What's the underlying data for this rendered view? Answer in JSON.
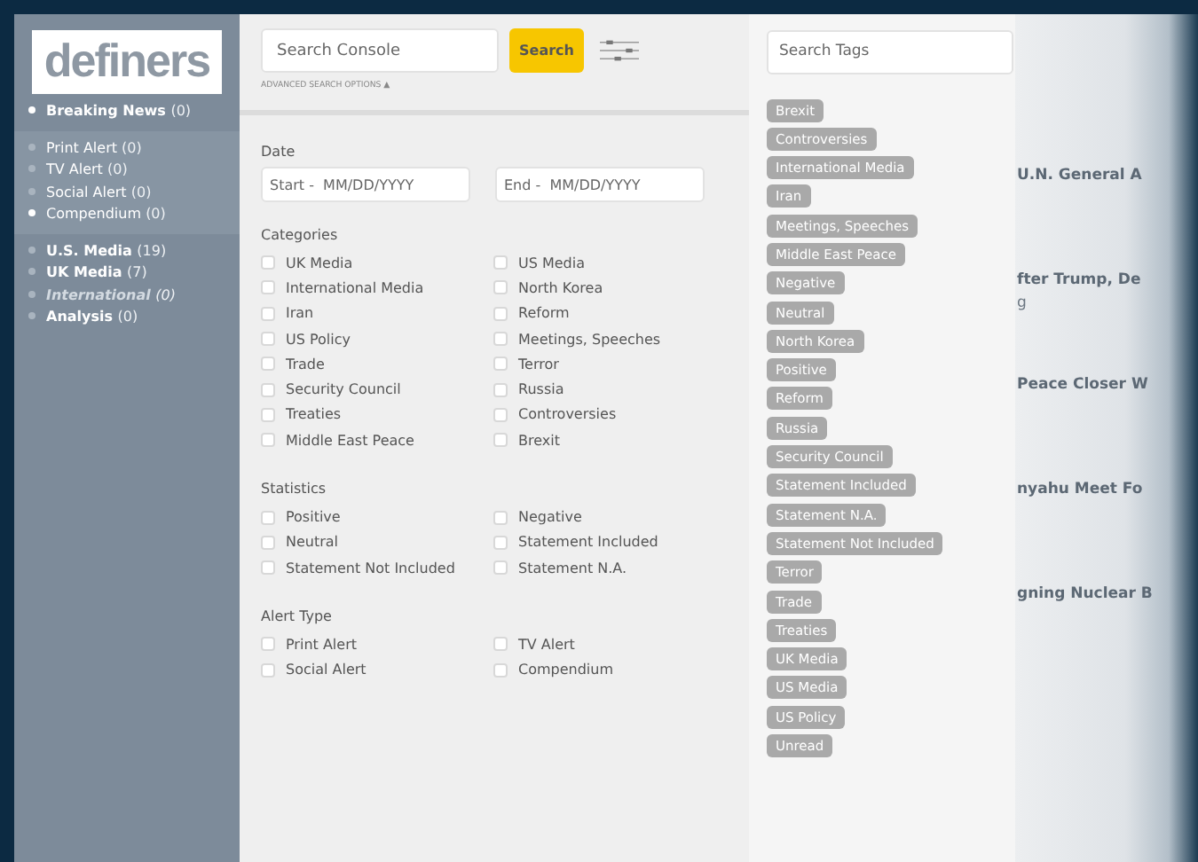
{
  "logo": "definers",
  "sidebar": {
    "groups": [
      {
        "kind": "plain",
        "items": [
          {
            "label": "Breaking News",
            "count": "(0)",
            "bold": true,
            "selected": true,
            "disabled": false
          }
        ]
      },
      {
        "kind": "band",
        "items": [
          {
            "label": "Print Alert",
            "count": "(0)",
            "bold": false,
            "selected": false,
            "disabled": false
          },
          {
            "label": "TV Alert",
            "count": "(0)",
            "bold": false,
            "selected": false,
            "disabled": false
          },
          {
            "label": "Social Alert",
            "count": "(0)",
            "bold": false,
            "selected": false,
            "disabled": false
          },
          {
            "label": "Compendium",
            "count": "(0)",
            "bold": false,
            "selected": true,
            "disabled": false
          }
        ]
      },
      {
        "kind": "plain",
        "items": [
          {
            "label": "U.S. Media",
            "count": "(19)",
            "bold": true,
            "selected": false,
            "disabled": false
          },
          {
            "label": "UK Media",
            "count": "(7)",
            "bold": true,
            "selected": false,
            "disabled": false
          },
          {
            "label": "International",
            "count": "(0)",
            "bold": true,
            "selected": false,
            "disabled": true
          },
          {
            "label": "Analysis",
            "count": "(0)",
            "bold": true,
            "selected": false,
            "disabled": false
          }
        ]
      }
    ]
  },
  "search": {
    "placeholder": "Search Console",
    "button": "Search",
    "advanced": "ADVANCED SEARCH OPTIONS ▲"
  },
  "date": {
    "label": "Date",
    "start_placeholder": "Start -  MM/DD/YYYY",
    "end_placeholder": "End -  MM/DD/YYYY"
  },
  "filter_groups": [
    {
      "title": "Categories",
      "options": [
        {
          "label": "UK Media",
          "checked": false
        },
        {
          "label": "US Media",
          "checked": false
        },
        {
          "label": "International Media",
          "checked": false
        },
        {
          "label": "North Korea",
          "checked": false
        },
        {
          "label": "Iran",
          "checked": false
        },
        {
          "label": "Reform",
          "checked": false
        },
        {
          "label": "US Policy",
          "checked": false
        },
        {
          "label": "Meetings, Speeches",
          "checked": false
        },
        {
          "label": "Trade",
          "checked": false
        },
        {
          "label": "Terror",
          "checked": false
        },
        {
          "label": "Security Council",
          "checked": false
        },
        {
          "label": "Russia",
          "checked": false
        },
        {
          "label": "Treaties",
          "checked": false
        },
        {
          "label": "Controversies",
          "checked": false
        },
        {
          "label": "Middle East Peace",
          "checked": false
        },
        {
          "label": "Brexit",
          "checked": false
        }
      ]
    },
    {
      "title": "Statistics",
      "options": [
        {
          "label": "Positive",
          "checked": false
        },
        {
          "label": "Negative",
          "checked": false
        },
        {
          "label": "Neutral",
          "checked": false
        },
        {
          "label": "Statement Included",
          "checked": false
        },
        {
          "label": "Statement Not Included",
          "checked": false
        },
        {
          "label": "Statement N.A.",
          "checked": false
        }
      ]
    },
    {
      "title": "Alert Type",
      "options": [
        {
          "label": "Print Alert",
          "checked": false
        },
        {
          "label": "TV Alert",
          "checked": false
        },
        {
          "label": "Social Alert",
          "checked": false
        },
        {
          "label": "Compendium",
          "checked": false
        }
      ]
    }
  ],
  "tags": {
    "placeholder": "Search Tags",
    "items": [
      "Brexit",
      "Controversies",
      "International Media",
      "Iran",
      "Meetings, Speeches",
      "Middle East Peace",
      "Negative",
      "Neutral",
      "North Korea",
      "Positive",
      "Reform",
      "Russia",
      "Security Council",
      "Statement Included",
      "Statement N.A.",
      "Statement Not Included",
      "Terror",
      "Trade",
      "Treaties",
      "UK Media",
      "US Media",
      "US Policy",
      "Unread"
    ]
  },
  "background_headlines": [
    {
      "title": "U.N. General A"
    },
    {
      "title": "fter Trump, De",
      "sub": "g"
    },
    {
      "title": "Peace Closer W"
    },
    {
      "title": "nyahu Meet Fo"
    },
    {
      "title": "gning Nuclear B"
    }
  ]
}
